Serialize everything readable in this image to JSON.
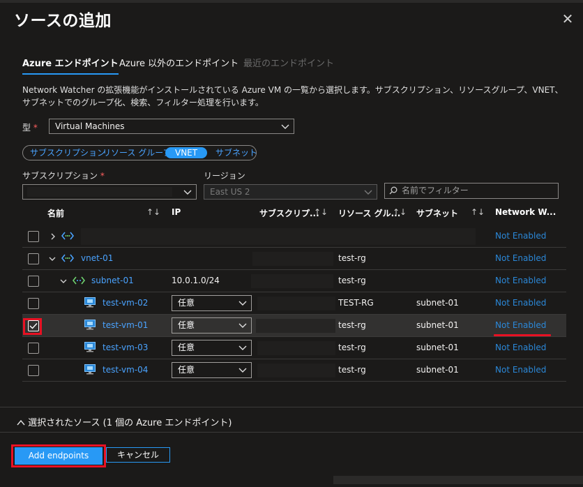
{
  "dialog": {
    "title": "ソースの追加"
  },
  "tabs": [
    {
      "label": "Azure エンドポイント",
      "state": "active"
    },
    {
      "label": "Azure 以外のエンドポイント",
      "state": "normal"
    },
    {
      "label": "最近のエンドポイント",
      "state": "disabled"
    }
  ],
  "description": "Network Watcher の拡張機能がインストールされている Azure VM の一覧から選択します。サブスクリプション、リソースグループ、VNET、サブネットでのグループ化、検索、フィルター処理を行います。",
  "type_field": {
    "label": "型",
    "required_mark": "*",
    "value": "Virtual Machines"
  },
  "group_pills": [
    {
      "label": "サブスクリプション",
      "selected": false
    },
    {
      "label": "リソース グループ",
      "selected": false
    },
    {
      "label": "VNET",
      "selected": true
    },
    {
      "label": "サブネット",
      "selected": false
    }
  ],
  "subscription_field": {
    "label": "サブスクリプション",
    "required_mark": "*",
    "value": ""
  },
  "region_field": {
    "label": "リージョン",
    "value": "East US 2"
  },
  "filter": {
    "placeholder": "名前でフィルター"
  },
  "columns": [
    "名前",
    "IP",
    "サブスクリプ...",
    "リソース グル...",
    "サブネット",
    "Network W..."
  ],
  "rows": [
    {
      "kind": "group",
      "expand": "collapsed",
      "name": "",
      "ip": "",
      "rg": "",
      "subnet": "",
      "status": "Not Enabled"
    },
    {
      "kind": "vnet",
      "expand": "expanded",
      "name": "vnet-01",
      "ip": "",
      "rg": "test-rg",
      "subnet": "",
      "status": "Not Enabled"
    },
    {
      "kind": "subnet",
      "expand": "expanded",
      "name": "subnet-01",
      "ip": "10.0.1.0/24",
      "rg": "test-rg",
      "subnet": "",
      "status": "Not Enabled"
    },
    {
      "kind": "vm",
      "name": "test-vm-02",
      "ip": "任意",
      "rg": "TEST-RG",
      "subnet": "subnet-01",
      "status": "Not Enabled",
      "checked": false
    },
    {
      "kind": "vm",
      "name": "test-vm-01",
      "ip": "任意",
      "rg": "test-rg",
      "subnet": "subnet-01",
      "status": "Not Enabled",
      "checked": true
    },
    {
      "kind": "vm",
      "name": "test-vm-03",
      "ip": "任意",
      "rg": "test-rg",
      "subnet": "subnet-01",
      "status": "Not Enabled",
      "checked": false
    },
    {
      "kind": "vm",
      "name": "test-vm-04",
      "ip": "任意",
      "rg": "test-rg",
      "subnet": "subnet-01",
      "status": "Not Enabled",
      "checked": false
    }
  ],
  "selected_sources": "選択されたソース (1 個の Azure エンドポイント)",
  "buttons": {
    "add": "Add endpoints",
    "cancel": "キャンセル"
  },
  "colors": {
    "accent": "#2899f5",
    "link": "#4aa3ff",
    "highlight": "#e81123"
  }
}
